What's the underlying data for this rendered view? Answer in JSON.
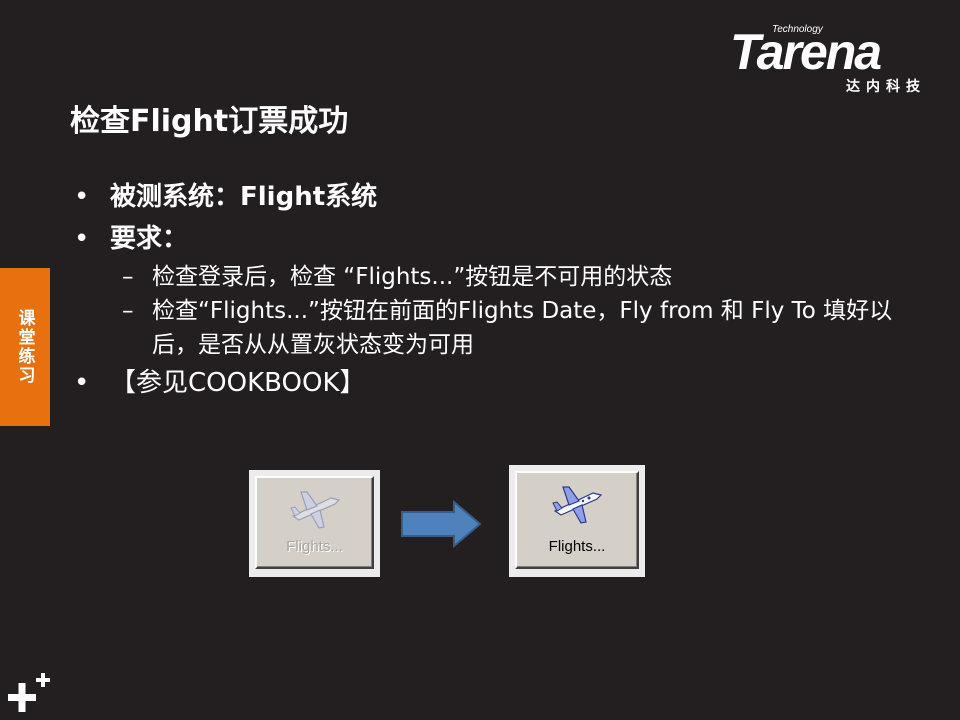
{
  "logo": {
    "tagline": "Technology",
    "wordmark": "Tarena",
    "chinese": "达内科技"
  },
  "slide": {
    "title": "检查Flight订票成功",
    "side_tab": "课堂练习"
  },
  "bullets": {
    "system": "被测系统：Flight系统",
    "requirement": "要求：",
    "sub_1": "检查登录后，检查 “Flights...”按钮是不可用的状态",
    "sub_2": "检查“Flights...”按钮在前面的Flights Date，Fly from 和 Fly To 填好以后，是否从从置灰状态变为可用",
    "reference": "【参见COOKBOOK】",
    "dash": "–"
  },
  "buttons": {
    "disabled_label": "Flights...",
    "enabled_label": "Flights..."
  },
  "colors": {
    "background": "#231f20",
    "side_tab": "#e8710f",
    "arrow": "#4f81bd"
  },
  "icons": {
    "plane": "airplane-icon",
    "arrow": "right-arrow-icon",
    "plus": "plus-decoration-icon"
  }
}
